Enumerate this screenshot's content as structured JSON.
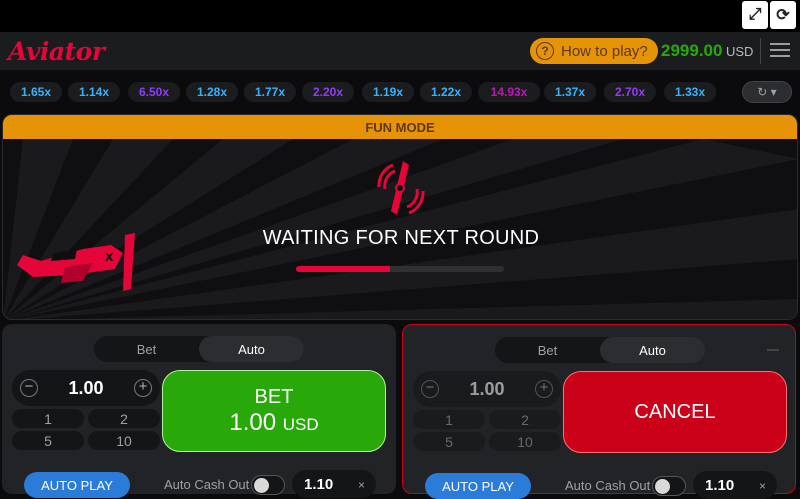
{
  "window_controls": {
    "fullscreen_glyph": "⤢",
    "reload_glyph": "⟳"
  },
  "header": {
    "logo": "Aviator",
    "how_to_play": "How to play?",
    "how_to_icon": "?",
    "balance": "2999.00",
    "currency": "USD"
  },
  "history": [
    {
      "value": "1.65x",
      "color": "#34b4ff"
    },
    {
      "value": "1.14x",
      "color": "#34b4ff"
    },
    {
      "value": "6.50x",
      "color": "#913ef8"
    },
    {
      "value": "1.28x",
      "color": "#34b4ff"
    },
    {
      "value": "1.77x",
      "color": "#34b4ff"
    },
    {
      "value": "2.20x",
      "color": "#913ef8"
    },
    {
      "value": "1.19x",
      "color": "#34b4ff"
    },
    {
      "value": "1.22x",
      "color": "#34b4ff"
    },
    {
      "value": "14.93x",
      "color": "#c017b4"
    },
    {
      "value": "1.37x",
      "color": "#34b4ff"
    },
    {
      "value": "2.70x",
      "color": "#913ef8"
    },
    {
      "value": "1.33x",
      "color": "#34b4ff"
    }
  ],
  "history_button_icon": "↻ ▾",
  "stage": {
    "mode": "FUN MODE",
    "status": "WAITING FOR NEXT ROUND",
    "progress": 0.45
  },
  "panels": [
    {
      "tabs": [
        "Bet",
        "Auto"
      ],
      "active_tab": 1,
      "stake": "1.00",
      "quick": [
        "1",
        "2",
        "5",
        "10"
      ],
      "button_label": "BET",
      "button_amount": "1.00",
      "button_currency": "USD",
      "autoplay": "AUTO PLAY",
      "auto_cashout_label": "Auto Cash Out",
      "auto_cashout_value": "1.10",
      "clear": "×"
    },
    {
      "tabs": [
        "Bet",
        "Auto"
      ],
      "active_tab": 1,
      "stake": "1.00",
      "quick": [
        "1",
        "2",
        "5",
        "10"
      ],
      "button_label": "CANCEL",
      "autoplay": "AUTO PLAY",
      "auto_cashout_label": "Auto Cash Out",
      "auto_cashout_value": "1.10",
      "clear": "×"
    }
  ],
  "colors": {
    "brand_red": "#e50539",
    "bet_green": "#28a909",
    "cancel_red": "#cb011a",
    "fun_orange": "#e69308",
    "balance_green": "#28a909"
  }
}
